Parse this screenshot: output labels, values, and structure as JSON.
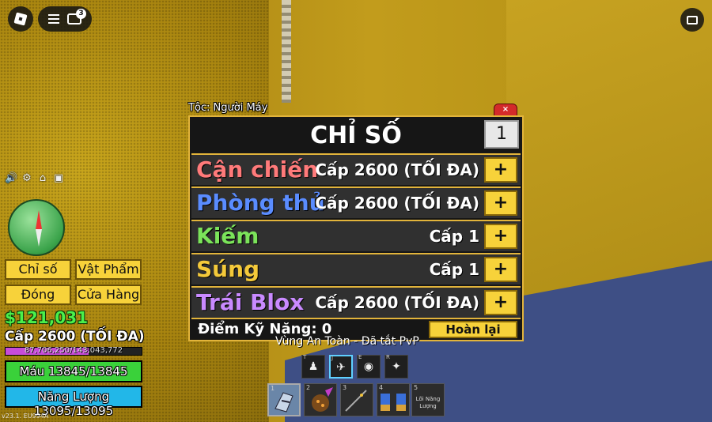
{
  "topbar": {
    "chat_badge": "3"
  },
  "hud": {
    "stats_button": "Chỉ số",
    "items_button": "Vật Phẩm",
    "close_button": "Đóng",
    "shop_button": "Cửa Hàng",
    "money": "$121,031",
    "level": "Cấp 2600 (TỐI ĐA)",
    "xp_text": "87,706,250/143,043,772",
    "xp_fraction": 0.613,
    "hp_text": "Máu 13845/13845",
    "hp_fraction": 1.0,
    "energy_text": "Năng Lượng 13095/13095",
    "energy_fraction": 1.0,
    "version": "v23.1. EU994A"
  },
  "panel": {
    "race_tag": "Tộc: Người Máy",
    "close_label": "×",
    "title": "CHỈ SỐ",
    "count": "1",
    "stats": [
      {
        "name": "Cận chiến",
        "level": "Cấp 2600 (TỐI ĐA)",
        "color": "#ff7a7a"
      },
      {
        "name": "Phòng thủ",
        "level": "Cấp 2600 (TỐI ĐA)",
        "color": "#5a8cff"
      },
      {
        "name": "Kiếm",
        "level": "Cấp 1",
        "color": "#7be35a"
      },
      {
        "name": "Súng",
        "level": "Cấp 1",
        "color": "#f4c93a"
      },
      {
        "name": "Trái Blox",
        "level": "Cấp 2600 (TỐI ĐA)",
        "color": "#c98aff"
      }
    ],
    "plus_label": "+",
    "points_text": "Điểm Kỹ Năng: 0",
    "reset_label": "Hoàn lại"
  },
  "zone_text": "Vùng An Toàn - Đã tắt PvP",
  "abilities": [
    {
      "key": "T",
      "icon": "♟"
    },
    {
      "key": "J",
      "icon": "✈"
    },
    {
      "key": "E",
      "icon": "◉"
    },
    {
      "key": "R",
      "icon": "✦"
    }
  ],
  "hotbar": [
    {
      "num": "1",
      "label": ""
    },
    {
      "num": "2",
      "label": ""
    },
    {
      "num": "3",
      "label": ""
    },
    {
      "num": "4",
      "label": ""
    },
    {
      "num": "5",
      "label": "Lõi Năng Lượng"
    }
  ]
}
